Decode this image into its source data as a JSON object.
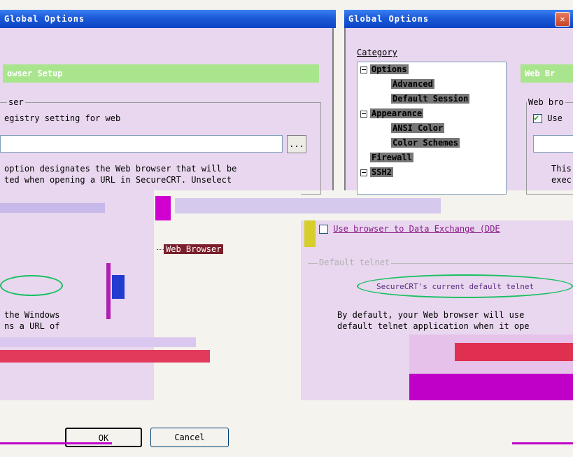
{
  "left_window": {
    "title": "Global Options",
    "section_header": "owser Setup",
    "group_label": "ser",
    "registry_text": "egistry setting for web",
    "description": [
      "option designates the Web browser that will be",
      "ted when opening a URL in SecureCRT.  Unselect"
    ],
    "lower_text": [
      "the Windows",
      "ns a URL of"
    ],
    "ok_label": "OK",
    "cancel_label": "Cancel",
    "browse_label": "..."
  },
  "right_window": {
    "title": "Global Options",
    "category_label": "Category",
    "tree": [
      {
        "label": "Options",
        "level": 0,
        "expander": true
      },
      {
        "label": "Advanced",
        "level": 1
      },
      {
        "label": "Default Session",
        "level": 1
      },
      {
        "label": "Appearance",
        "level": 0,
        "expander": true
      },
      {
        "label": "ANSI Color",
        "level": 1
      },
      {
        "label": "Color Schemes",
        "level": 1
      },
      {
        "label": "Firewall",
        "level": 0
      },
      {
        "label": "SSH2",
        "level": 0,
        "expander": true
      },
      {
        "label": "Web Browser",
        "level": 1,
        "selected": true
      }
    ],
    "section_header": "Web Br",
    "group_label": "Web bro",
    "use_label": "Use",
    "use_checked": true,
    "right_desc": [
      "This",
      "exec"
    ],
    "dde_label": "Use browser to Data Exchange (DDE",
    "default_telnet_label": "Default telnet",
    "telnet_value": "SecureCRT's current default telnet",
    "default_text": [
      "By default, your Web browser will use",
      "default telnet application when it ope"
    ]
  },
  "colors": {
    "panel": "#e8d7ee",
    "header": "#a9e58d",
    "selection": "#7a1f2b",
    "title_bar": "#1c5ad8"
  }
}
